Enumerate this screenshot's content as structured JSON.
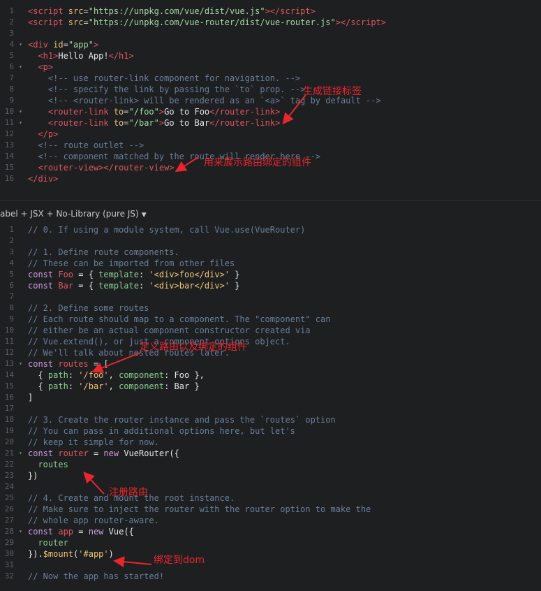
{
  "html_editor": {
    "lines": [
      {
        "n": "1",
        "fold": false,
        "tokens": [
          [
            "tag",
            "<script"
          ],
          [
            "attr",
            " src"
          ],
          [
            "punc",
            "="
          ],
          [
            "str",
            "\"https://unpkg.com/vue/dist/vue.js\""
          ],
          [
            "tag",
            ">"
          ],
          [
            "tag",
            "</script"
          ],
          [
            "tag",
            ">"
          ]
        ]
      },
      {
        "n": "2",
        "fold": false,
        "tokens": [
          [
            "tag",
            "<script"
          ],
          [
            "attr",
            " src"
          ],
          [
            "punc",
            "="
          ],
          [
            "str",
            "\"https://unpkg.com/vue-router/dist/vue-router.js\""
          ],
          [
            "tag",
            ">"
          ],
          [
            "tag",
            "</script"
          ],
          [
            "tag",
            ">"
          ]
        ]
      },
      {
        "n": "3",
        "fold": false,
        "tokens": []
      },
      {
        "n": "4",
        "fold": true,
        "tokens": [
          [
            "tag",
            "<div"
          ],
          [
            "attr",
            " id"
          ],
          [
            "punc",
            "="
          ],
          [
            "str",
            "\"app\""
          ],
          [
            "tag",
            ">"
          ]
        ]
      },
      {
        "n": "5",
        "fold": false,
        "tokens": [
          [
            "txt",
            "  "
          ],
          [
            "tag",
            "<h1>"
          ],
          [
            "txt",
            "Hello App!"
          ],
          [
            "tag",
            "</h1>"
          ]
        ]
      },
      {
        "n": "6",
        "fold": true,
        "tokens": [
          [
            "txt",
            "  "
          ],
          [
            "tag",
            "<p>"
          ]
        ]
      },
      {
        "n": "7",
        "fold": false,
        "tokens": [
          [
            "cmt",
            "    <!-- use router-link component for navigation. -->"
          ]
        ]
      },
      {
        "n": "8",
        "fold": false,
        "tokens": [
          [
            "cmt",
            "    <!-- specify the link by passing the `to` prop. -->"
          ]
        ]
      },
      {
        "n": "9",
        "fold": false,
        "tokens": [
          [
            "cmt",
            "    <!-- <router-link> will be rendered as an `<a>` tag by default -->"
          ]
        ]
      },
      {
        "n": "10",
        "fold": true,
        "tokens": [
          [
            "txt",
            "    "
          ],
          [
            "tag",
            "<router-link"
          ],
          [
            "attr",
            " to"
          ],
          [
            "punc",
            "="
          ],
          [
            "str",
            "\"/foo\""
          ],
          [
            "tag",
            ">"
          ],
          [
            "txt",
            "Go to Foo"
          ],
          [
            "tag",
            "</router-link"
          ],
          [
            "tag",
            ">"
          ]
        ]
      },
      {
        "n": "11",
        "fold": true,
        "tokens": [
          [
            "txt",
            "    "
          ],
          [
            "tag",
            "<router-link"
          ],
          [
            "attr",
            " to"
          ],
          [
            "punc",
            "="
          ],
          [
            "str",
            "\"/bar\""
          ],
          [
            "tag",
            ">"
          ],
          [
            "txt",
            "Go to Bar"
          ],
          [
            "tag",
            "</router-link"
          ],
          [
            "tag",
            ">"
          ]
        ]
      },
      {
        "n": "12",
        "fold": false,
        "tokens": [
          [
            "txt",
            "  "
          ],
          [
            "tag",
            "</p>"
          ]
        ]
      },
      {
        "n": "13",
        "fold": false,
        "tokens": [
          [
            "cmt",
            "  <!-- route outlet -->"
          ]
        ]
      },
      {
        "n": "14",
        "fold": false,
        "tokens": [
          [
            "cmt",
            "  <!-- component matched by the route will render here -->"
          ]
        ]
      },
      {
        "n": "15",
        "fold": false,
        "tokens": [
          [
            "txt",
            "  "
          ],
          [
            "tag",
            "<router-view"
          ],
          [
            "tag",
            ">"
          ],
          [
            "tag",
            "</router-view"
          ],
          [
            "tag",
            ">"
          ]
        ]
      },
      {
        "n": "16",
        "fold": false,
        "tokens": [
          [
            "tag",
            "</div>"
          ]
        ]
      }
    ]
  },
  "js_language_selector": {
    "label": "abel + JSX + No-Library (pure JS)",
    "caret": "▼"
  },
  "js_editor": {
    "lines": [
      {
        "n": "1",
        "fold": false,
        "tokens": [
          [
            "cmt",
            "// 0. If using a module system, call Vue.use(VueRouter)"
          ]
        ]
      },
      {
        "n": "2",
        "fold": false,
        "tokens": []
      },
      {
        "n": "3",
        "fold": false,
        "tokens": [
          [
            "cmt",
            "// 1. Define route components."
          ]
        ]
      },
      {
        "n": "4",
        "fold": false,
        "tokens": [
          [
            "cmt",
            "// These can be imported from other files"
          ]
        ]
      },
      {
        "n": "5",
        "fold": false,
        "tokens": [
          [
            "kw",
            "const"
          ],
          [
            "txt",
            " "
          ],
          [
            "tag",
            "Foo"
          ],
          [
            "txt",
            " = { "
          ],
          [
            "prop",
            "template"
          ],
          [
            "txt",
            ": "
          ],
          [
            "strj",
            "'<div>foo</div>'"
          ],
          [
            "txt",
            " }"
          ]
        ]
      },
      {
        "n": "6",
        "fold": false,
        "tokens": [
          [
            "kw",
            "const"
          ],
          [
            "txt",
            " "
          ],
          [
            "tag",
            "Bar"
          ],
          [
            "txt",
            " = { "
          ],
          [
            "prop",
            "template"
          ],
          [
            "txt",
            ": "
          ],
          [
            "strj",
            "'<div>bar</div>'"
          ],
          [
            "txt",
            " }"
          ]
        ]
      },
      {
        "n": "7",
        "fold": false,
        "tokens": []
      },
      {
        "n": "8",
        "fold": false,
        "tokens": [
          [
            "cmt",
            "// 2. Define some routes"
          ]
        ]
      },
      {
        "n": "9",
        "fold": false,
        "tokens": [
          [
            "cmt",
            "// Each route should map to a component. The \"component\" can"
          ]
        ]
      },
      {
        "n": "10",
        "fold": false,
        "tokens": [
          [
            "cmt",
            "// either be an actual component constructor created via"
          ]
        ]
      },
      {
        "n": "11",
        "fold": false,
        "tokens": [
          [
            "cmt",
            "// Vue.extend(), or just a component options object."
          ]
        ]
      },
      {
        "n": "12",
        "fold": false,
        "tokens": [
          [
            "cmt",
            "// We'll talk about nested routes later."
          ]
        ]
      },
      {
        "n": "13",
        "fold": true,
        "tokens": [
          [
            "kw",
            "const"
          ],
          [
            "txt",
            " "
          ],
          [
            "tag",
            "routes"
          ],
          [
            "txt",
            " = ["
          ]
        ]
      },
      {
        "n": "14",
        "fold": false,
        "tokens": [
          [
            "txt",
            "  { "
          ],
          [
            "prop",
            "path"
          ],
          [
            "txt",
            ": "
          ],
          [
            "strj",
            "'/foo'"
          ],
          [
            "txt",
            ", "
          ],
          [
            "prop",
            "component"
          ],
          [
            "txt",
            ": Foo },"
          ]
        ]
      },
      {
        "n": "15",
        "fold": false,
        "tokens": [
          [
            "txt",
            "  { "
          ],
          [
            "prop",
            "path"
          ],
          [
            "txt",
            ": "
          ],
          [
            "strj",
            "'/bar'"
          ],
          [
            "txt",
            ", "
          ],
          [
            "prop",
            "component"
          ],
          [
            "txt",
            ": Bar }"
          ]
        ]
      },
      {
        "n": "16",
        "fold": false,
        "tokens": [
          [
            "txt",
            "]"
          ]
        ]
      },
      {
        "n": "17",
        "fold": false,
        "tokens": []
      },
      {
        "n": "18",
        "fold": false,
        "tokens": [
          [
            "cmt",
            "// 3. Create the router instance and pass the `routes` option"
          ]
        ]
      },
      {
        "n": "19",
        "fold": false,
        "tokens": [
          [
            "cmt",
            "// You can pass in additional options here, but let's"
          ]
        ]
      },
      {
        "n": "20",
        "fold": false,
        "tokens": [
          [
            "cmt",
            "// keep it simple for now."
          ]
        ]
      },
      {
        "n": "21",
        "fold": true,
        "tokens": [
          [
            "kw",
            "const"
          ],
          [
            "txt",
            " "
          ],
          [
            "tag",
            "router"
          ],
          [
            "txt",
            " = "
          ],
          [
            "kw",
            "new"
          ],
          [
            "txt",
            " VueRouter({"
          ]
        ]
      },
      {
        "n": "22",
        "fold": false,
        "tokens": [
          [
            "txt",
            "  "
          ],
          [
            "prop",
            "routes"
          ]
        ]
      },
      {
        "n": "23",
        "fold": false,
        "tokens": [
          [
            "txt",
            "})"
          ]
        ]
      },
      {
        "n": "24",
        "fold": false,
        "tokens": []
      },
      {
        "n": "25",
        "fold": false,
        "tokens": [
          [
            "cmt",
            "// 4. Create and mount the root instance."
          ]
        ]
      },
      {
        "n": "26",
        "fold": false,
        "tokens": [
          [
            "cmt",
            "// Make sure to inject the router with the router option to make the"
          ]
        ]
      },
      {
        "n": "27",
        "fold": false,
        "tokens": [
          [
            "cmt",
            "// whole app router-aware."
          ]
        ]
      },
      {
        "n": "28",
        "fold": true,
        "tokens": [
          [
            "kw",
            "const"
          ],
          [
            "txt",
            " "
          ],
          [
            "tag",
            "app"
          ],
          [
            "txt",
            " = "
          ],
          [
            "kw",
            "new"
          ],
          [
            "txt",
            " Vue({"
          ]
        ]
      },
      {
        "n": "29",
        "fold": false,
        "tokens": [
          [
            "txt",
            "  "
          ],
          [
            "prop",
            "router"
          ]
        ]
      },
      {
        "n": "30",
        "fold": false,
        "tokens": [
          [
            "txt",
            "})."
          ],
          [
            "fn",
            "$mount"
          ],
          [
            "txt",
            "("
          ],
          [
            "strj",
            "'#app'"
          ],
          [
            "txt",
            ")"
          ]
        ]
      },
      {
        "n": "31",
        "fold": false,
        "tokens": []
      },
      {
        "n": "32",
        "fold": false,
        "tokens": [
          [
            "cmt",
            "// Now the app has started!"
          ]
        ]
      }
    ]
  },
  "annotations": [
    {
      "id": "generate-link",
      "text": "生成链接标签"
    },
    {
      "id": "route-view",
      "text": "用来展示路由绑定的组件"
    },
    {
      "id": "define-routes",
      "text": "定义路由以及绑定的组件"
    },
    {
      "id": "register-router",
      "text": "注册路由"
    },
    {
      "id": "bind-dom",
      "text": "绑定到dom"
    }
  ],
  "colors": {
    "annotation": "#e8262d",
    "background": "#1d1f21"
  }
}
